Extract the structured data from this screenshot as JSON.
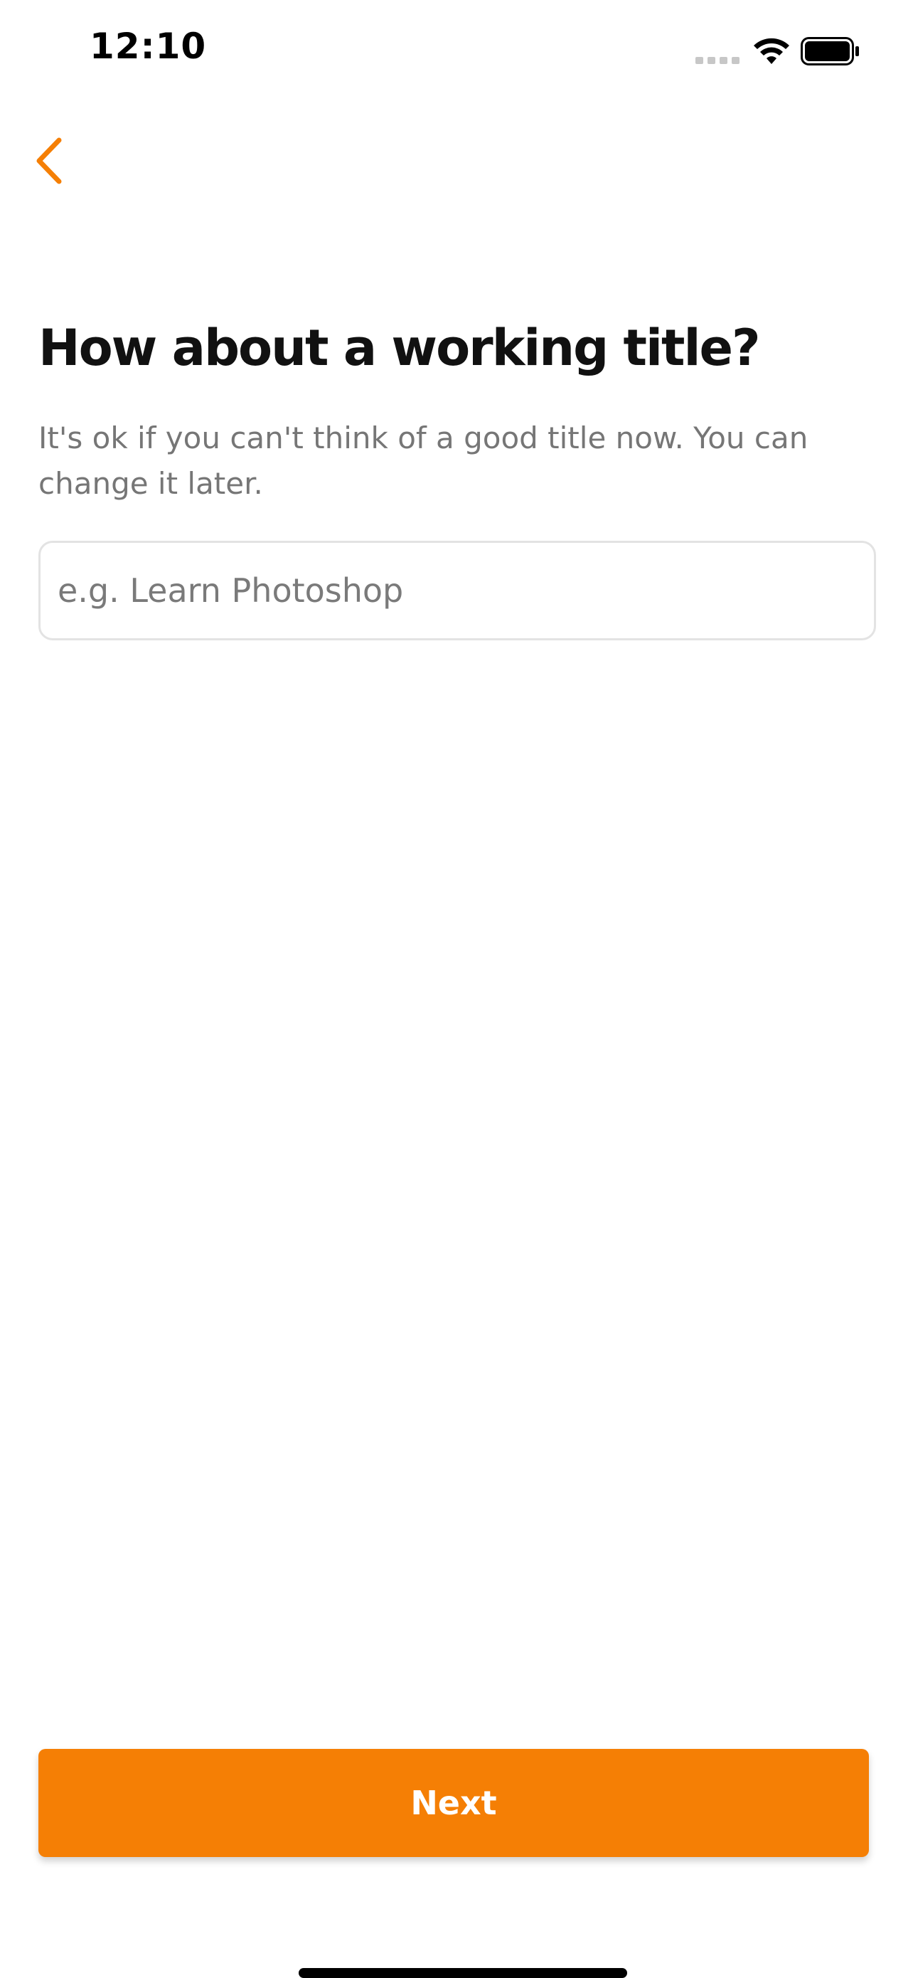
{
  "status_bar": {
    "time": "12:10"
  },
  "icons": {
    "back": "chevron-left-icon",
    "signal": "cellular-signal-icon",
    "wifi": "wifi-icon",
    "battery": "battery-icon"
  },
  "main": {
    "title": "How about a working title?",
    "subtitle": "It's ok if you can't think of a good title now. You can change it later.",
    "input": {
      "value": "",
      "placeholder": "e.g. Learn Photoshop"
    },
    "next_label": "Next"
  },
  "colors": {
    "accent": "#f57f05",
    "title_text": "#111111",
    "subtitle_text": "#767676",
    "input_border": "#e3e3e3"
  }
}
